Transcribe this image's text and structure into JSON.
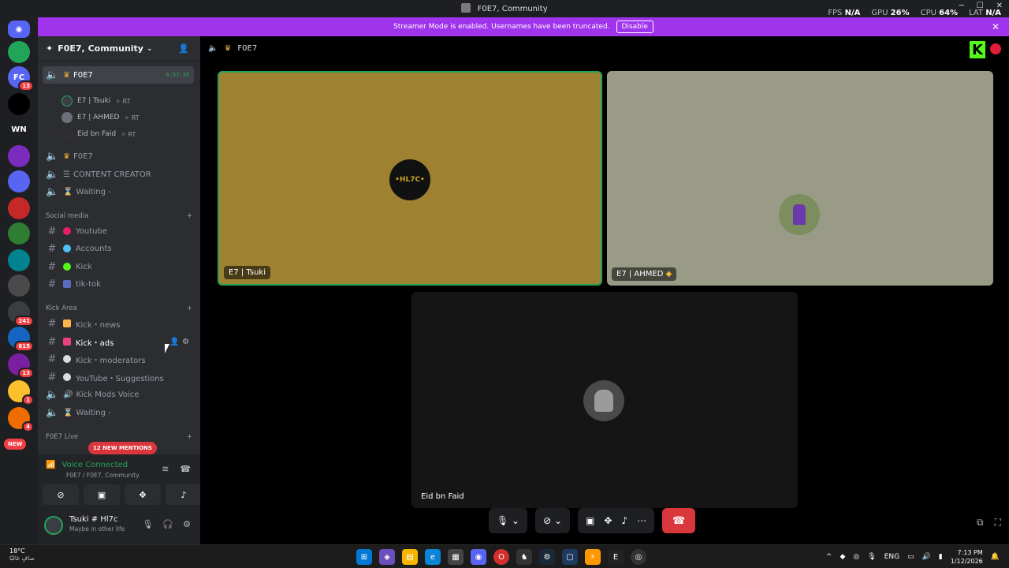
{
  "window": {
    "title": "F0E7, Community",
    "stats": {
      "fps_label": "FPS",
      "fps_val": "N/A",
      "gpu_label": "GPU",
      "gpu_val": "26%",
      "cpu_label": "CPU",
      "cpu_val": "64%",
      "lat_label": "LAT",
      "lat_val": "N/A"
    }
  },
  "banner": {
    "text": "Streamer Mode is enabled. Usernames have been truncated.",
    "disable": "Disable"
  },
  "servers": [
    {
      "label": "",
      "color": "#23a559"
    },
    {
      "label": "FC",
      "color": "#5865f2",
      "badge": "13"
    },
    {
      "label": "",
      "color": "#000000"
    },
    {
      "label": "WN",
      "color": "#1e1f22"
    },
    {
      "label": "",
      "color": "#7b2cbf"
    },
    {
      "label": "",
      "color": "#5865f2"
    },
    {
      "label": "",
      "color": "#c62828"
    },
    {
      "label": "",
      "color": "#2e7d32"
    },
    {
      "label": "",
      "color": "#00838f"
    },
    {
      "label": "",
      "color": "#4a4a4a"
    },
    {
      "label": "",
      "color": "#3a3d41",
      "badge": "241"
    },
    {
      "label": "",
      "color": "#1565c0",
      "badge": "615"
    },
    {
      "label": "",
      "color": "#7b1fa2",
      "badge": "13"
    },
    {
      "label": "",
      "color": "#fbc02d",
      "badge": "1"
    },
    {
      "label": "",
      "color": "#ef6c00",
      "badge": "4"
    }
  ],
  "new_badge": "NEW",
  "guild": {
    "name": "F0E7, Community"
  },
  "channels": {
    "active_voice": {
      "name": "F0E7",
      "timer": "6:52:35"
    },
    "voice_users": [
      {
        "name": "E7 | Tsuki",
        "tag": "RT"
      },
      {
        "name": "E7 | AHMED",
        "tag": "RT"
      },
      {
        "name": "Eid bn Faid",
        "tag": "RT"
      }
    ],
    "voice_rooms": [
      "F0E7",
      "CONTENT CREATOR",
      "Waiting -"
    ],
    "social_cat": "Social media",
    "social": [
      "Youtube",
      "Accounts",
      "Kick",
      "tik-tok"
    ],
    "kick_cat": "Kick Area",
    "kick": [
      "Kick・news",
      "Kick・ads",
      "Kick・moderators",
      "YouTube・Suggestions",
      "Kick Mods Voice",
      "Waiting -"
    ],
    "live_cat": "F0E7 Live",
    "mentions": "12 NEW MENTIONS"
  },
  "voice_panel": {
    "status": "Voice Connected",
    "sub": "F0E7 / F0E7, Community"
  },
  "user": {
    "name": "Tsuki # Hl7c",
    "status": "Maybe in other life"
  },
  "stage": {
    "channel_name": "F0E7",
    "tiles": [
      {
        "name": "E7 | Tsuki",
        "avatar_text": "•HL7C•"
      },
      {
        "name": "E7 | AHMED"
      },
      {
        "name": "Eid bn Faid"
      }
    ]
  },
  "taskbar": {
    "temp": "18°C",
    "weather": "صافٍ غالبًا",
    "lang": "ENG",
    "time": "7:13 PM",
    "date": "1/12/2026"
  },
  "colors": {
    "accent": "#5865f2",
    "streamer": "#a033ec",
    "green": "#23a559",
    "danger": "#da373c",
    "kick": "#53fc18"
  }
}
